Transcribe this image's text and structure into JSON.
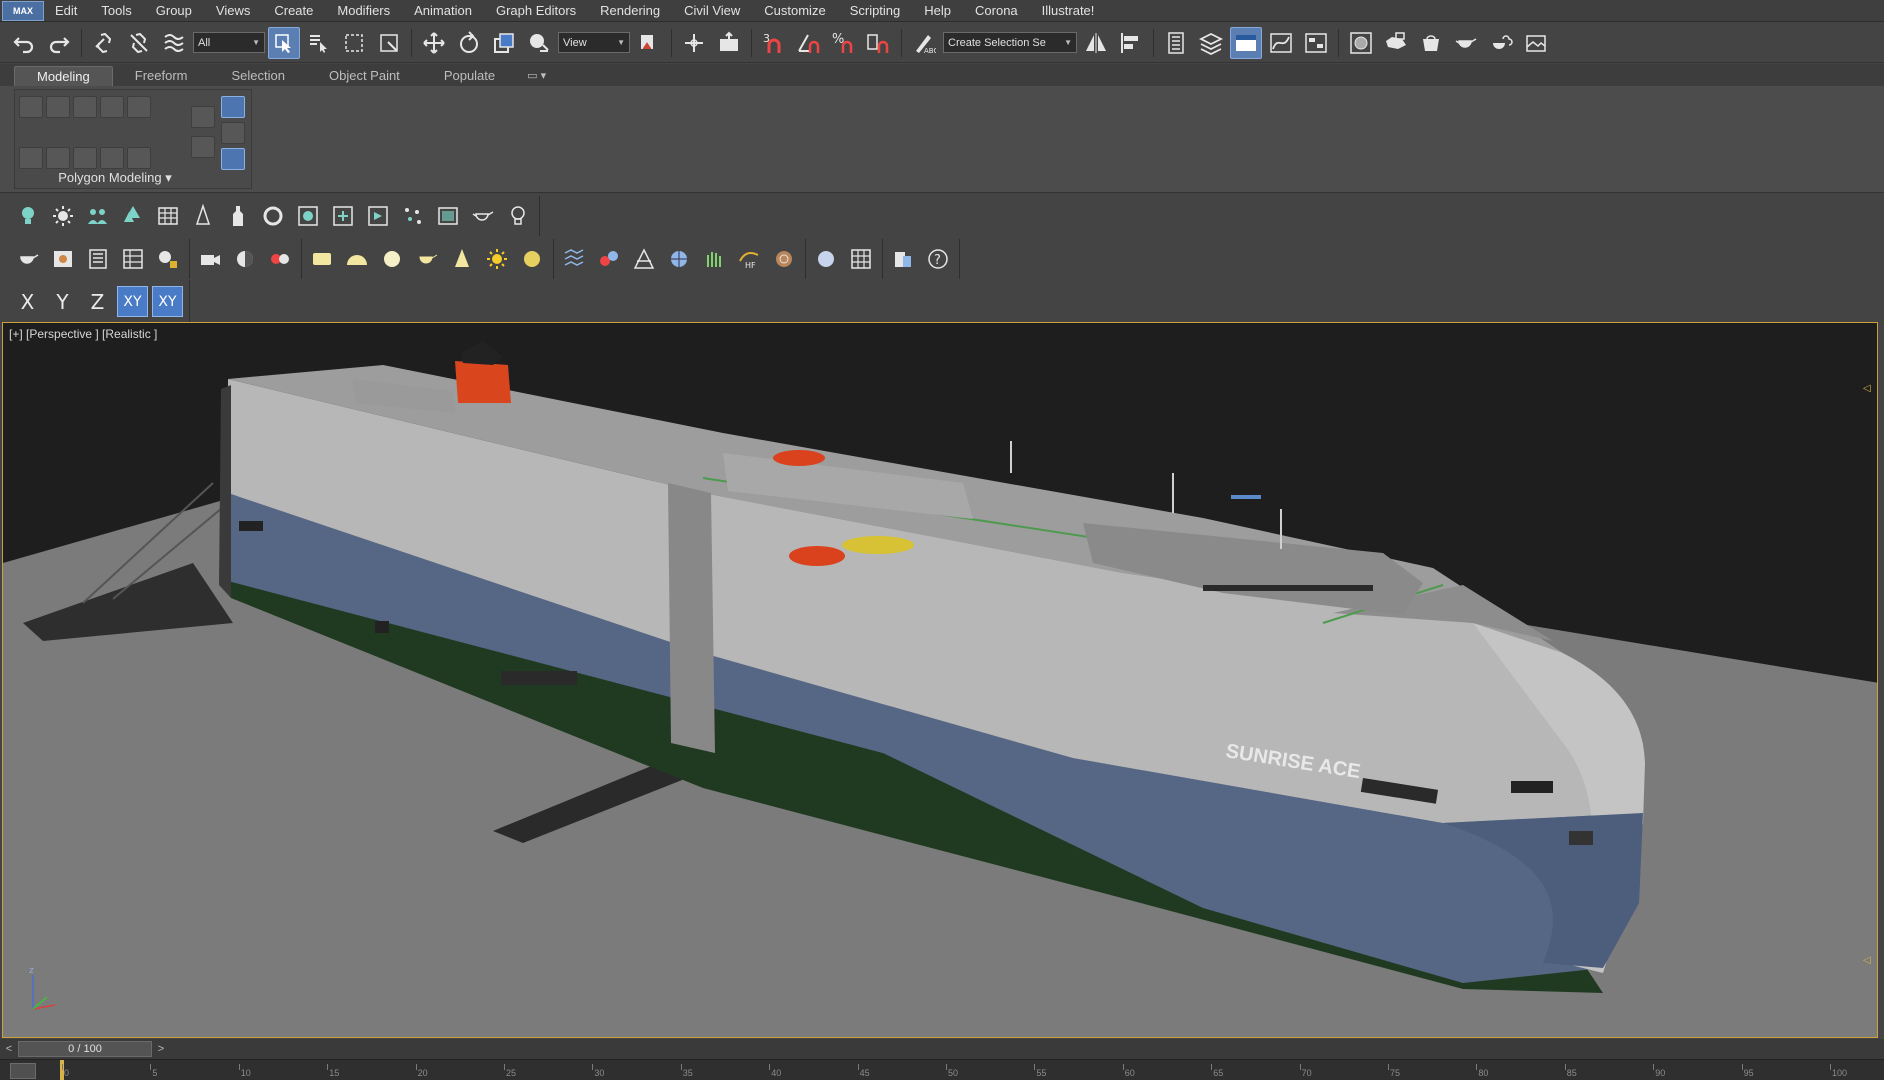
{
  "app": {
    "logo": "MAX"
  },
  "menu": [
    "Edit",
    "Tools",
    "Group",
    "Views",
    "Create",
    "Modifiers",
    "Animation",
    "Graph Editors",
    "Rendering",
    "Civil View",
    "Customize",
    "Scripting",
    "Help",
    "Corona",
    "Illustrate!"
  ],
  "toolbar": {
    "selection_filter": "All",
    "ref_coord": "View",
    "snap_label_angle": "3",
    "named_selection_placeholder": "Create Selection Se"
  },
  "ribbon": {
    "tabs": [
      "Modeling",
      "Freeform",
      "Selection",
      "Object Paint",
      "Populate"
    ],
    "active_tab": "Modeling",
    "group_label": "Polygon Modeling"
  },
  "axis": {
    "x": "X",
    "y": "Y",
    "z": "Z",
    "xy": "XY",
    "xy_lock": "XY"
  },
  "viewport": {
    "label": "[+] [Perspective ] [Realistic ]",
    "ship_name": "SUNRISE ACE"
  },
  "timeline": {
    "frame_display": "0 / 100",
    "ticks": [
      0,
      5,
      10,
      15,
      20,
      25,
      30,
      35,
      40,
      45,
      50,
      55,
      60,
      65,
      70,
      75,
      80,
      85,
      90,
      95,
      100
    ],
    "current_frame": 0
  },
  "colors": {
    "active_blue": "#4a7bc6",
    "viewport_border": "#c9a43a",
    "hull_blue": "#5a6b87",
    "hull_white": "#bdbdbd",
    "funnel": "#d9461e",
    "lifeboat": "#d9421c",
    "helipad": "#d6c234"
  }
}
